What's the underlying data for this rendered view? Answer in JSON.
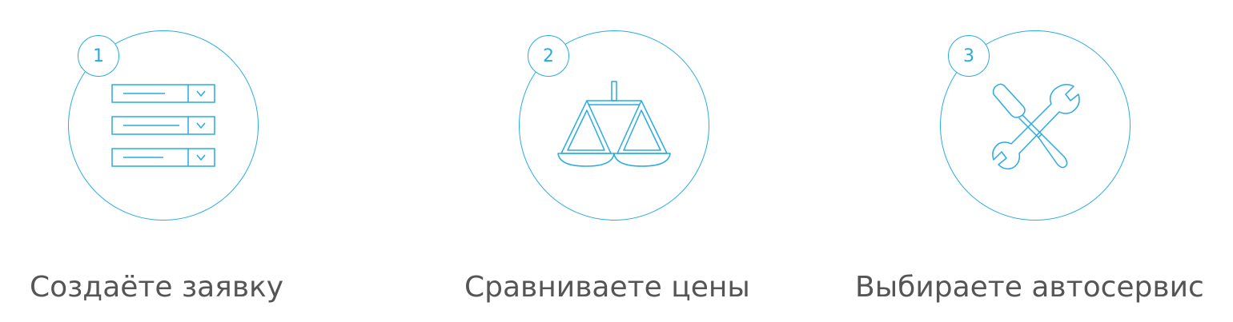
{
  "steps": [
    {
      "number": "1",
      "label": "Создаёте заявку",
      "icon": "form-dropdowns-icon"
    },
    {
      "number": "2",
      "label": "Сравниваете цены",
      "icon": "scales-icon"
    },
    {
      "number": "3",
      "label": "Выбираете автосервис",
      "icon": "wrench-screwdriver-icon"
    }
  ],
  "colors": {
    "accent": "#29abe2",
    "label_text": "#555555",
    "background": "#ffffff"
  }
}
